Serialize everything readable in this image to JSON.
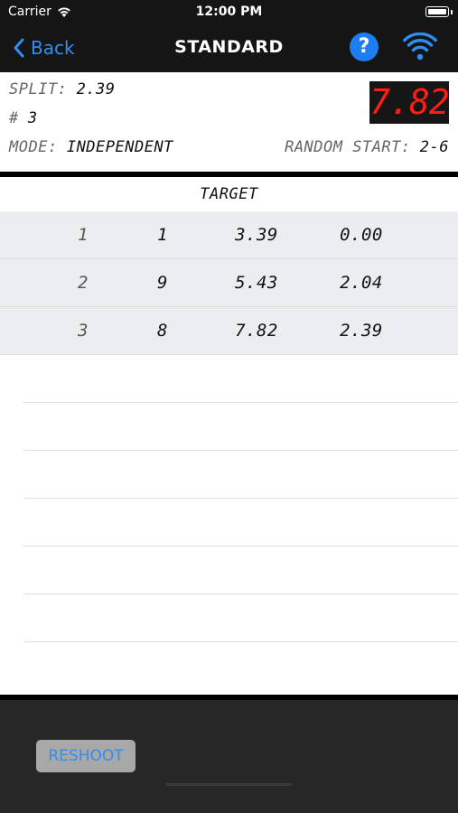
{
  "status": {
    "carrier": "Carrier",
    "time": "12:00 PM"
  },
  "nav": {
    "back_label": "Back",
    "title": "STANDARD",
    "help_icon": "?"
  },
  "info": {
    "split_label": "SPLIT:",
    "split_value": "2.39",
    "shot_label": "#",
    "shot_value": "3",
    "mode_label": "MODE:",
    "mode_value": "INDEPENDENT",
    "random_label": "RANDOM START:",
    "random_value": "2-6",
    "timer": "7.82"
  },
  "table": {
    "header": "TARGET",
    "rows": [
      {
        "shot": "1",
        "target": "1",
        "time": "3.39",
        "split": "0.00"
      },
      {
        "shot": "2",
        "target": "9",
        "time": "5.43",
        "split": "2.04"
      },
      {
        "shot": "3",
        "target": "8",
        "time": "7.82",
        "split": "2.39"
      }
    ]
  },
  "toolbar": {
    "reshoot_label": "RESHOOT"
  },
  "colors": {
    "accent": "#2f8ef5",
    "timer": "#ff1e14",
    "help": "#1c7ef0"
  }
}
